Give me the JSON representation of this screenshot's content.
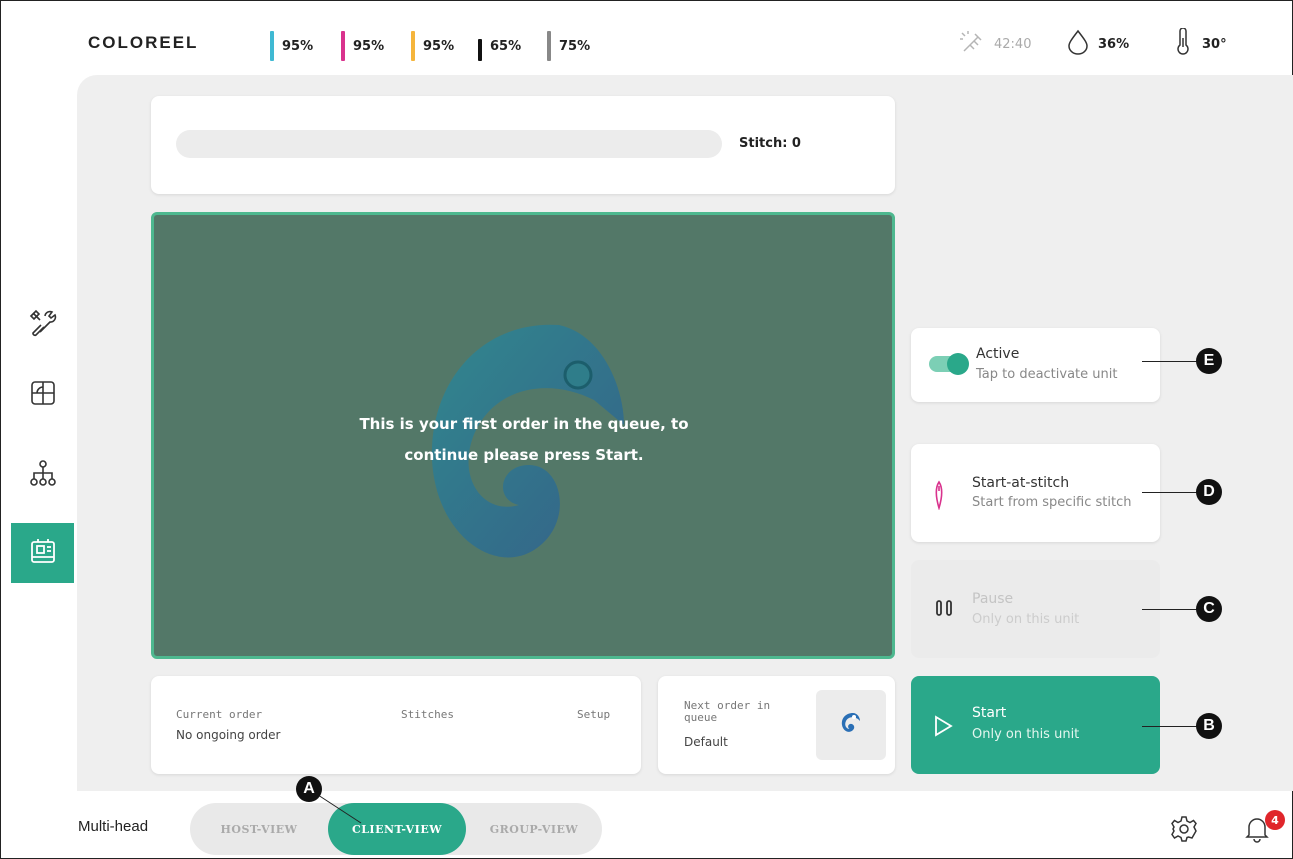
{
  "header": {
    "brand": "COLOREEL",
    "inks": [
      {
        "color": "#3fb9d3",
        "value": "95%"
      },
      {
        "color": "#d9328d",
        "value": "95%"
      },
      {
        "color": "#f5b53c",
        "value": "95%"
      },
      {
        "color": "#111111",
        "value": "65%"
      },
      {
        "color": "#888888",
        "value": "75%"
      }
    ],
    "time": "42:40",
    "humidity": "36%",
    "temperature": "30°"
  },
  "nav": {
    "items": [
      {
        "icon": "tools-icon"
      },
      {
        "icon": "design-icon"
      },
      {
        "icon": "network-icon"
      },
      {
        "icon": "machine-icon",
        "active": true
      }
    ]
  },
  "progress": {
    "stitch_label": "Stitch: 0",
    "fraction": 0
  },
  "preview": {
    "message_line1": "This is your first order in the queue, to",
    "message_line2": "continue please press Start."
  },
  "order": {
    "current_label": "Current order",
    "current_value": "No ongoing order",
    "stitches_label": "Stitches",
    "setup_label": "Setup"
  },
  "next_order": {
    "label": "Next order in queue",
    "value": "Default"
  },
  "actions": {
    "active": {
      "title": "Active",
      "sub": "Tap to deactivate unit",
      "callout": "E"
    },
    "start_at_stitch": {
      "title": "Start-at-stitch",
      "sub": "Start from specific stitch",
      "callout": "D"
    },
    "pause": {
      "title": "Pause",
      "sub": "Only on this unit",
      "callout": "C"
    },
    "start": {
      "title": "Start",
      "sub": "Only on this unit",
      "callout": "B"
    }
  },
  "footer": {
    "mode_label": "Multi-head",
    "views": [
      "HOST-VIEW",
      "CLIENT-VIEW",
      "GROUP-VIEW"
    ],
    "active_view": "CLIENT-VIEW",
    "view_callout": "A",
    "notification_count": "4"
  },
  "colors": {
    "accent": "#2aa88a",
    "preview_bg": "#537868",
    "badge": "#e0262b"
  }
}
